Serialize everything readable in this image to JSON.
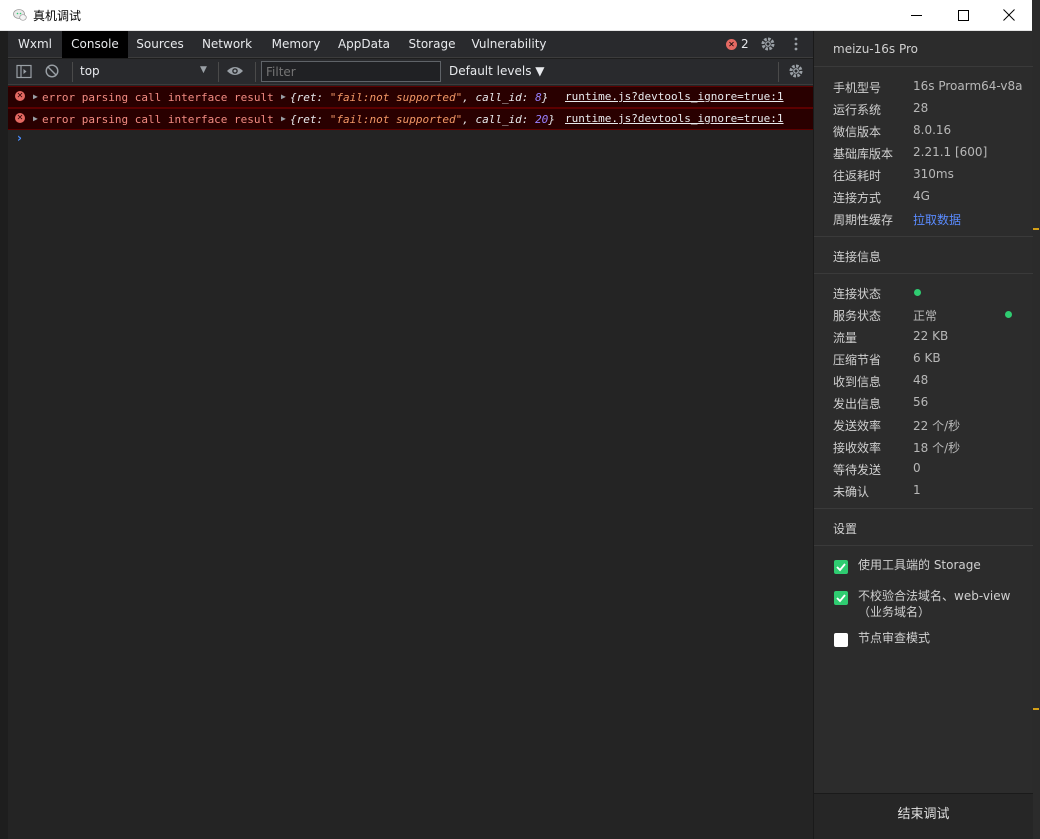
{
  "window": {
    "title": "真机调试"
  },
  "tabs": [
    "Wxml",
    "Console",
    "Sources",
    "Network",
    "Memory",
    "AppData",
    "Storage",
    "Vulnerability"
  ],
  "active_tab": "Console",
  "error_count": "2",
  "toolbar": {
    "context": "top",
    "filter_placeholder": "Filter",
    "levels": "Default levels ▼"
  },
  "messages": [
    {
      "text": "error parsing call interface result",
      "obj_open": "{ret: ",
      "ret": "\"fail:not supported\"",
      "mid": ", call_id: ",
      "call_id": "8",
      "obj_close": "}",
      "source": "runtime.js?devtools_ignore=true:1"
    },
    {
      "text": "error parsing call interface result",
      "obj_open": "{ret: ",
      "ret": "\"fail:not supported\"",
      "mid": ", call_id: ",
      "call_id": "20",
      "obj_close": "}",
      "source": "runtime.js?devtools_ignore=true:1"
    }
  ],
  "panel": {
    "device": "meizu-16s Pro",
    "info": [
      {
        "label": "手机型号",
        "value": "16s Proarm64-v8a"
      },
      {
        "label": "运行系统",
        "value": "28"
      },
      {
        "label": "微信版本",
        "value": "8.0.16"
      },
      {
        "label": "基础库版本",
        "value": "2.21.1 [600]"
      },
      {
        "label": "往返耗时",
        "value": "310ms"
      },
      {
        "label": "连接方式",
        "value": "4G"
      },
      {
        "label": "周期性缓存",
        "value": "拉取数据"
      }
    ],
    "conn_title": "连接信息",
    "conn": [
      {
        "label": "连接状态",
        "value": ""
      },
      {
        "label": "服务状态",
        "value": "正常"
      },
      {
        "label": "流量",
        "value": "22 KB"
      },
      {
        "label": "压缩节省",
        "value": "6 KB"
      },
      {
        "label": "收到信息",
        "value": "48"
      },
      {
        "label": "发出信息",
        "value": "56"
      },
      {
        "label": "发送效率",
        "value": "22 个/秒"
      },
      {
        "label": "接收效率",
        "value": "18 个/秒"
      },
      {
        "label": "等待发送",
        "value": "0"
      },
      {
        "label": "未确认",
        "value": "1"
      }
    ],
    "settings_title": "设置",
    "settings": [
      {
        "label": "使用工具端的 Storage",
        "checked": true
      },
      {
        "label": "不校验合法域名、web-view（业务域名）",
        "checked": true
      },
      {
        "label": "节点审查模式",
        "checked": false
      }
    ],
    "end_button": "结束调试"
  },
  "colors": {
    "error_bg": "#290000",
    "error_text": "#f28b82",
    "status_green": "#2fcc71",
    "link_blue": "#5a8bff"
  }
}
